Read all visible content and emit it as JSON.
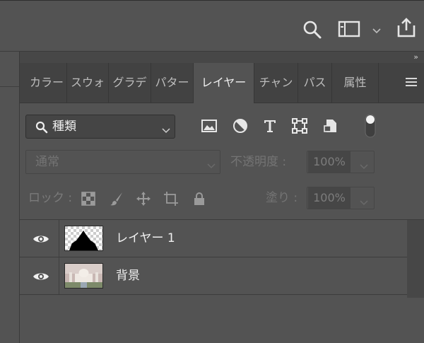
{
  "colors": {
    "panel_bg": "#535353",
    "tab_bar": "#424242",
    "text": "#f0f0f0",
    "dim_text": "#747474"
  },
  "toolbar": {
    "icons": [
      "search-icon",
      "workspace-icon",
      "chevron-down-icon",
      "share-icon"
    ]
  },
  "panel": {
    "collapse_glyph": "»",
    "tabs": [
      {
        "label": "カラー",
        "active": false
      },
      {
        "label": "スウォ",
        "active": false
      },
      {
        "label": "グラデ",
        "active": false
      },
      {
        "label": "パター",
        "active": false
      },
      {
        "label": "レイヤー",
        "active": true
      },
      {
        "label": "チャン",
        "active": false
      },
      {
        "label": "パス",
        "active": false
      },
      {
        "label": "属性",
        "active": false
      }
    ],
    "menu_icon": "hamburger-icon"
  },
  "filter": {
    "label": "種類",
    "icons": [
      "image-filter-icon",
      "adjustment-filter-icon",
      "type-filter-icon",
      "shape-filter-icon",
      "smart-object-filter-icon"
    ]
  },
  "blend": {
    "mode": "通常",
    "opacity_label": "不透明度 :",
    "opacity_value": "100%"
  },
  "lock": {
    "label": "ロック :",
    "icons": [
      "lock-transparent-icon",
      "lock-paint-icon",
      "lock-position-icon",
      "artboard-lock-icon",
      "lock-all-icon"
    ],
    "fill_label": "塗り :",
    "fill_value": "100%"
  },
  "layers": [
    {
      "name": "レイヤー 1",
      "visible": true
    },
    {
      "name": "背景",
      "visible": true
    }
  ]
}
